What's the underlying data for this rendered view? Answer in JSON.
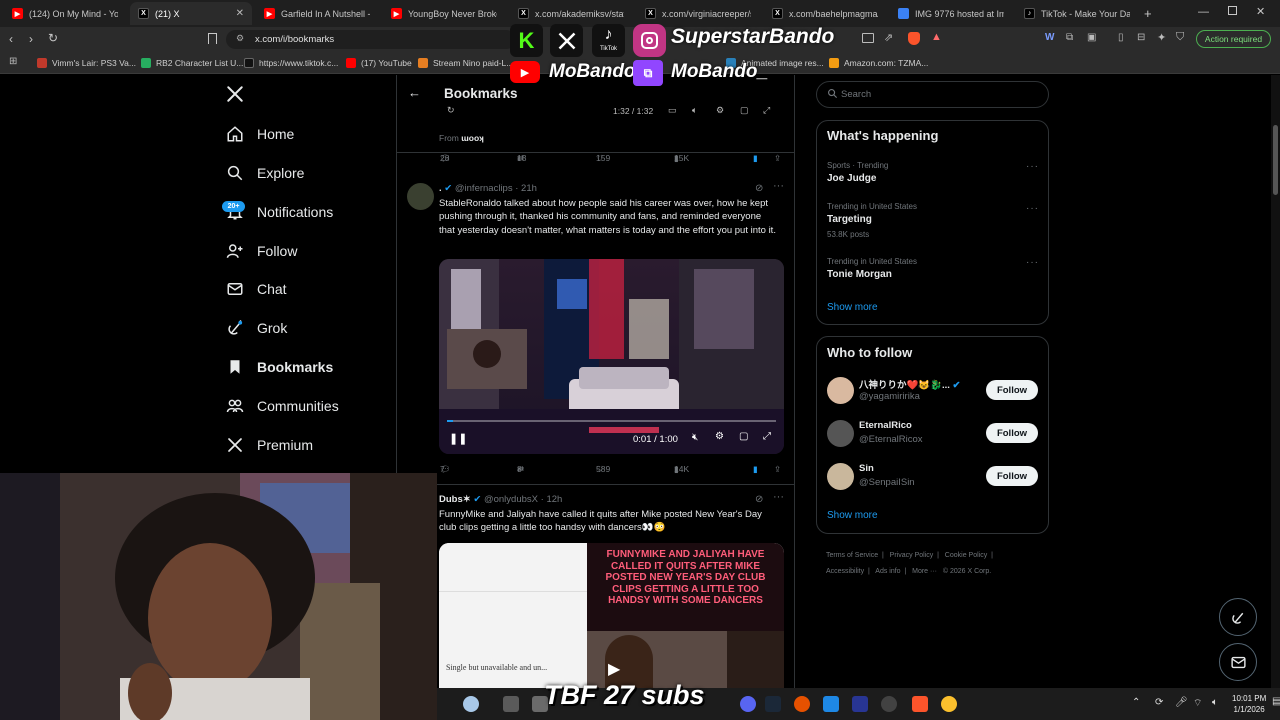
{
  "browser": {
    "tabs": [
      {
        "title": "(124) On My Mind - YouTu",
        "favicon_color": "#ff0000"
      },
      {
        "title": "(21) X",
        "favicon_color": "#000000",
        "active": true
      },
      {
        "title": "Garfield In A Nutshell - Yo",
        "favicon_color": "#ff0000"
      },
      {
        "title": "YoungBoy Never Broke Ag",
        "favicon_color": "#ff0000"
      },
      {
        "title": "x.com/akademiksv/status",
        "favicon_color": "#000000"
      },
      {
        "title": "x.com/virginiacreeper/stat",
        "favicon_color": "#000000"
      },
      {
        "title": "x.com/baehelpmagma/sta",
        "favicon_color": "#000000"
      },
      {
        "title": "IMG 9776 hosted at ImgB",
        "favicon_color": "#3b82f6"
      },
      {
        "title": "TikTok - Make Your Day",
        "favicon_color": "#000000"
      }
    ],
    "url": "x.com/i/bookmarks",
    "action_required": "Action required",
    "bookmarks": [
      {
        "label": "Vimm's Lair: PS3 Va...",
        "color": "#c0392b"
      },
      {
        "label": "RB2 Character List U...",
        "color": "#27ae60"
      },
      {
        "label": "https://www.tiktok.c...",
        "color": "#000000"
      },
      {
        "label": "(17) YouTube",
        "color": "#ff0000"
      },
      {
        "label": "Stream Nino paid-L...",
        "color": "#e67e22"
      },
      {
        "label": "Animated image res...",
        "color": "#2980b9"
      },
      {
        "label": "Amazon.com: TZMA...",
        "color": "#f39c12"
      }
    ]
  },
  "overlay": {
    "streamer_name": "SuperstarBando",
    "youtube_name": "MoBando",
    "twitch_name": "MoBando_",
    "tiktok_label": "TikTok",
    "subs_text": "TBF 27 subs"
  },
  "x": {
    "nav": [
      {
        "label": "Home",
        "icon": "home-icon"
      },
      {
        "label": "Explore",
        "icon": "search-icon"
      },
      {
        "label": "Notifications",
        "icon": "bell-icon",
        "badge": "20+"
      },
      {
        "label": "Follow",
        "icon": "add-person-icon"
      },
      {
        "label": "Chat",
        "icon": "mail-icon"
      },
      {
        "label": "Grok",
        "icon": "grok-icon"
      },
      {
        "label": "Bookmarks",
        "icon": "bookmark-icon",
        "active": true
      },
      {
        "label": "Communities",
        "icon": "people-icon"
      },
      {
        "label": "Premium",
        "icon": "x-logo-icon"
      }
    ],
    "header_title": "Bookmarks",
    "prev_tweet": {
      "video_time": "1:32 / 1:32",
      "from_label": "From",
      "from_name": "ɯooʞ",
      "replies": "28",
      "reposts": "13",
      "likes": "159",
      "views": "15K"
    },
    "tweet1": {
      "name": ".",
      "handle": "@infernaclips",
      "time": "21h",
      "text": "StableRonaldo talked about how people said his career was over, how he kept pushing through it, thanked his community and fans, and reminded everyone that yesterday doesn't matter, what matters is today and the effort you put into it.",
      "video_time": "0:01 / 1:00",
      "video_progress": 0.017,
      "replies": "7",
      "reposts": "8",
      "likes": "589",
      "views": "14K"
    },
    "tweet2": {
      "name": "Dubs✶",
      "handle": "@onlydubsX",
      "time": "12h",
      "text": "FunnyMike and Jaliyah have called it quits after Mike posted New Year's Day club clips getting a little too handsy with dancers👀😳",
      "image_caption": "FUNNYMIKE AND JALIYAH HAVE CALLED IT QUITS AFTER MIKE POSTED NEW YEAR'S DAY CLUB CLIPS GETTING A LITTLE TOO HANDSY WITH SOME DANCERS",
      "image_subtext": "Single but unavailable and un..."
    },
    "search_placeholder": "Search",
    "whats_happening": {
      "title": "What's happening",
      "trends": [
        {
          "meta": "Sports · Trending",
          "name": "Joe Judge",
          "posts": ""
        },
        {
          "meta": "Trending in United States",
          "name": "Targeting",
          "posts": "53.8K posts"
        },
        {
          "meta": "Trending in United States",
          "name": "Tonie Morgan",
          "posts": ""
        }
      ],
      "show_more": "Show more"
    },
    "who_to_follow": {
      "title": "Who to follow",
      "accounts": [
        {
          "name": "八神りりか❤️😺🐉...",
          "handle": "@yagamiririka",
          "verified": true,
          "follow": "Follow",
          "avatar_color": "#d9b9a0"
        },
        {
          "name": "EternalRico",
          "handle": "@EternalRicox",
          "verified": false,
          "follow": "Follow",
          "avatar_color": "#555555"
        },
        {
          "name": "Sin",
          "handle": "@SenpaiISin",
          "verified": false,
          "follow": "Follow",
          "avatar_color": "#c9b79c"
        }
      ],
      "show_more": "Show more"
    },
    "footer": {
      "links": [
        "Terms of Service",
        "Privacy Policy",
        "Cookie Policy",
        "Accessibility",
        "Ads info",
        "More ···"
      ],
      "copyright": "© 2026 X Corp."
    }
  },
  "taskbar": {
    "time": "10:01 PM",
    "date": "1/1/2026"
  },
  "colors": {
    "accent": "#1d9bf0",
    "background": "#000000",
    "border": "#2f3336",
    "muted": "#71767b"
  }
}
